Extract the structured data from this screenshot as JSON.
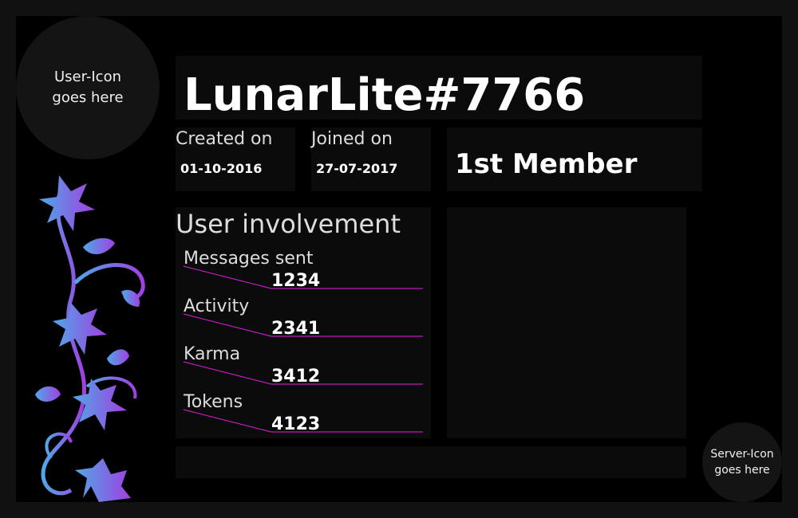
{
  "profile": {
    "username": "LunarLite#7766",
    "user_icon_text": "User-Icon\ngoes here",
    "server_icon_text": "Server-Icon\ngoes here",
    "created": {
      "label": "Created on",
      "value": "01-10-2016"
    },
    "joined": {
      "label": "Joined on",
      "value": "27-07-2017"
    },
    "rank": "1st Member"
  },
  "involvement": {
    "title": "User involvement",
    "stats": [
      {
        "label": "Messages sent",
        "value": "1234"
      },
      {
        "label": "Activity",
        "value": "2341"
      },
      {
        "label": "Karma",
        "value": "3412"
      },
      {
        "label": "Tokens",
        "value": "4123"
      }
    ]
  },
  "colors": {
    "background": "#000000",
    "panel": "#0b0b0b",
    "accent_line": "#e020e0",
    "flower_gradient_start": "#4fa8e8",
    "flower_gradient_end": "#a040e0"
  },
  "decorations": {
    "flower": "floral-vine-icon"
  }
}
